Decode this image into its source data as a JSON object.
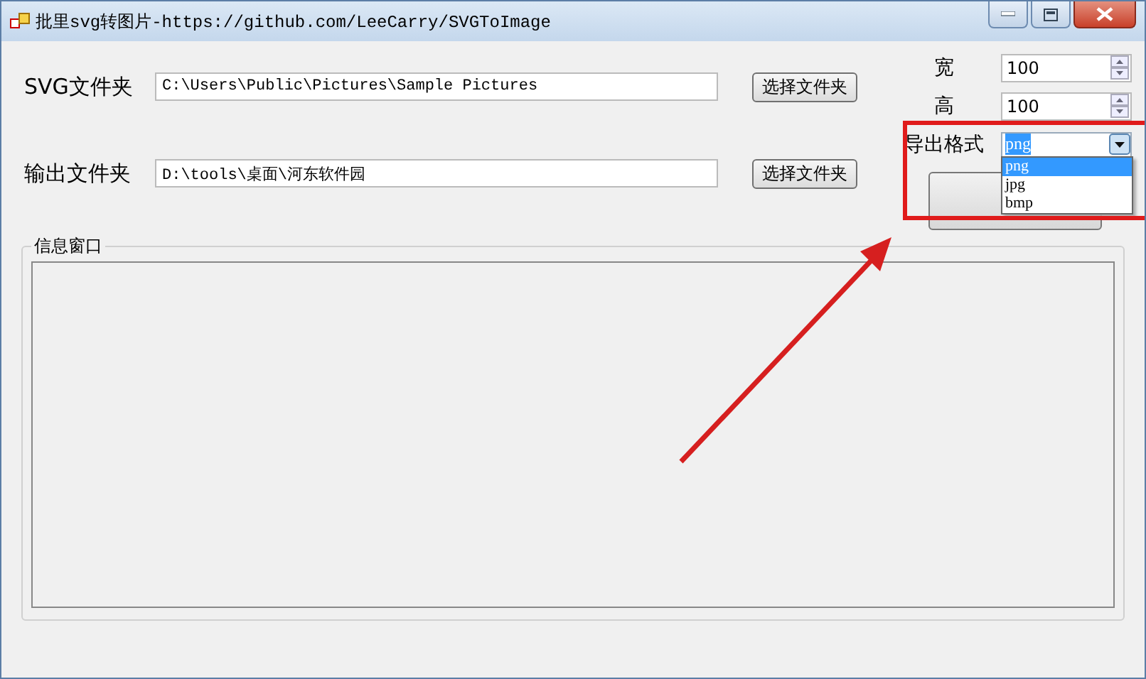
{
  "window": {
    "title": "批里svg转图片-https://github.com/LeeCarry/SVGToImage"
  },
  "folders": [
    {
      "label": "SVG文件夹",
      "value": "C:\\Users\\Public\\Pictures\\Sample Pictures",
      "button": "选择文件夹"
    },
    {
      "label": "输出文件夹",
      "value": "D:\\tools\\桌面\\河东软件园",
      "button": "选择文件夹"
    }
  ],
  "size_fields": [
    {
      "label": "宽",
      "value": "100"
    },
    {
      "label": "高",
      "value": "100"
    }
  ],
  "format": {
    "label": "导出格式",
    "value": "png",
    "expanded": true,
    "options": [
      {
        "label": "png",
        "selected": true
      },
      {
        "label": "jpg",
        "selected": false
      },
      {
        "label": "bmp",
        "selected": false
      }
    ]
  },
  "info_group": {
    "title": "信息窗口"
  }
}
